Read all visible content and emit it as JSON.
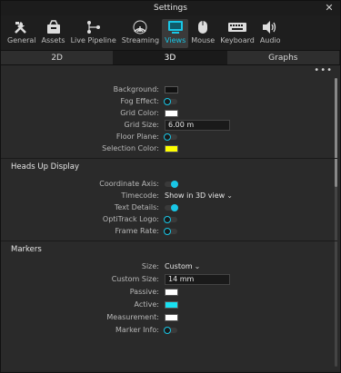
{
  "window": {
    "title": "Settings"
  },
  "toolbar": {
    "items": [
      {
        "label": "General",
        "icon": "tools-icon"
      },
      {
        "label": "Assets",
        "icon": "box-icon"
      },
      {
        "label": "Live Pipeline",
        "icon": "pipeline-icon"
      },
      {
        "label": "Streaming",
        "icon": "broadcast-icon"
      },
      {
        "label": "Views",
        "icon": "monitor-icon"
      },
      {
        "label": "Mouse",
        "icon": "mouse-icon"
      },
      {
        "label": "Keyboard",
        "icon": "keyboard-icon"
      },
      {
        "label": "Audio",
        "icon": "speaker-icon"
      }
    ],
    "active": "Views",
    "accent": "#19c6e6"
  },
  "tabs": [
    {
      "label": "2D"
    },
    {
      "label": "3D"
    },
    {
      "label": "Graphs"
    }
  ],
  "more_glyph": "•••",
  "view3d": {
    "background": {
      "label": "Background:",
      "color": "#1a1a1a"
    },
    "fog_effect": {
      "label": "Fog Effect:",
      "on": false
    },
    "grid_color": {
      "label": "Grid Color:",
      "color": "#ffffff"
    },
    "grid_size": {
      "label": "Grid Size:",
      "value": "6.00 m"
    },
    "floor_plane": {
      "label": "Floor Plane:",
      "on": false
    },
    "selection_color": {
      "label": "Selection Color:",
      "color": "#ffff00"
    }
  },
  "hud": {
    "title": "Heads Up Display",
    "coordinate_axis": {
      "label": "Coordinate Axis:",
      "on": true
    },
    "timecode": {
      "label": "Timecode:",
      "value": "Show in 3D view"
    },
    "text_details": {
      "label": "Text Details:",
      "on": true
    },
    "optitrack_logo": {
      "label": "OptiTrack Logo:",
      "on": false
    },
    "frame_rate": {
      "label": "Frame Rate:",
      "on": false
    }
  },
  "markers": {
    "title": "Markers",
    "size": {
      "label": "Size:",
      "value": "Custom"
    },
    "custom_size": {
      "label": "Custom Size:",
      "value": "14 mm"
    },
    "passive": {
      "label": "Passive:",
      "color": "#ffffff"
    },
    "active": {
      "label": "Active:",
      "color": "#19e0f0"
    },
    "measurement": {
      "label": "Measurement:",
      "color": "#ffffff"
    },
    "marker_info": {
      "label": "Marker Info:",
      "on": false
    }
  }
}
